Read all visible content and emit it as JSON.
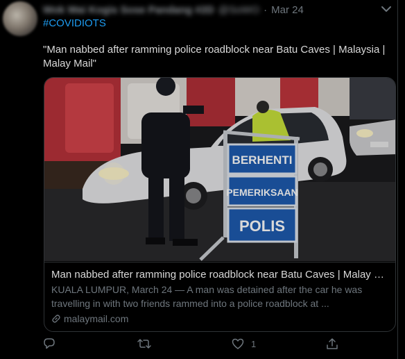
{
  "tweet": {
    "author_name_blurred": "Wok Wai Kogis Sose Pandang #2D",
    "author_handle_blurred": "@SoWO",
    "separator": "·",
    "date": "Mar 24",
    "hashtag": "#COVIDIOTS",
    "text": "\"Man nabbed after ramming police roadblock near Batu Caves | Malaysia | Malay Mail\""
  },
  "card": {
    "image_signs": [
      "BERHENTI",
      "PEMERIKSAAN",
      "POLIS"
    ],
    "title": "Man nabbed after ramming police roadblock near Batu Caves | Malay Mail",
    "description": "KUALA LUMPUR, March 24 — A man was detained after the car he was travelling in with two friends rammed into a police roadblock at ...",
    "domain": "malaymail.com"
  },
  "actions": {
    "reply_count": "",
    "retweet_count": "",
    "like_count": "1",
    "icons": [
      "reply-icon",
      "retweet-icon",
      "like-icon",
      "share-icon"
    ]
  },
  "colors": {
    "background": "#000000",
    "link": "#1d9bf0",
    "muted": "#6e767d",
    "border": "#2f3336",
    "sign_blue": "#1e5bb0"
  }
}
